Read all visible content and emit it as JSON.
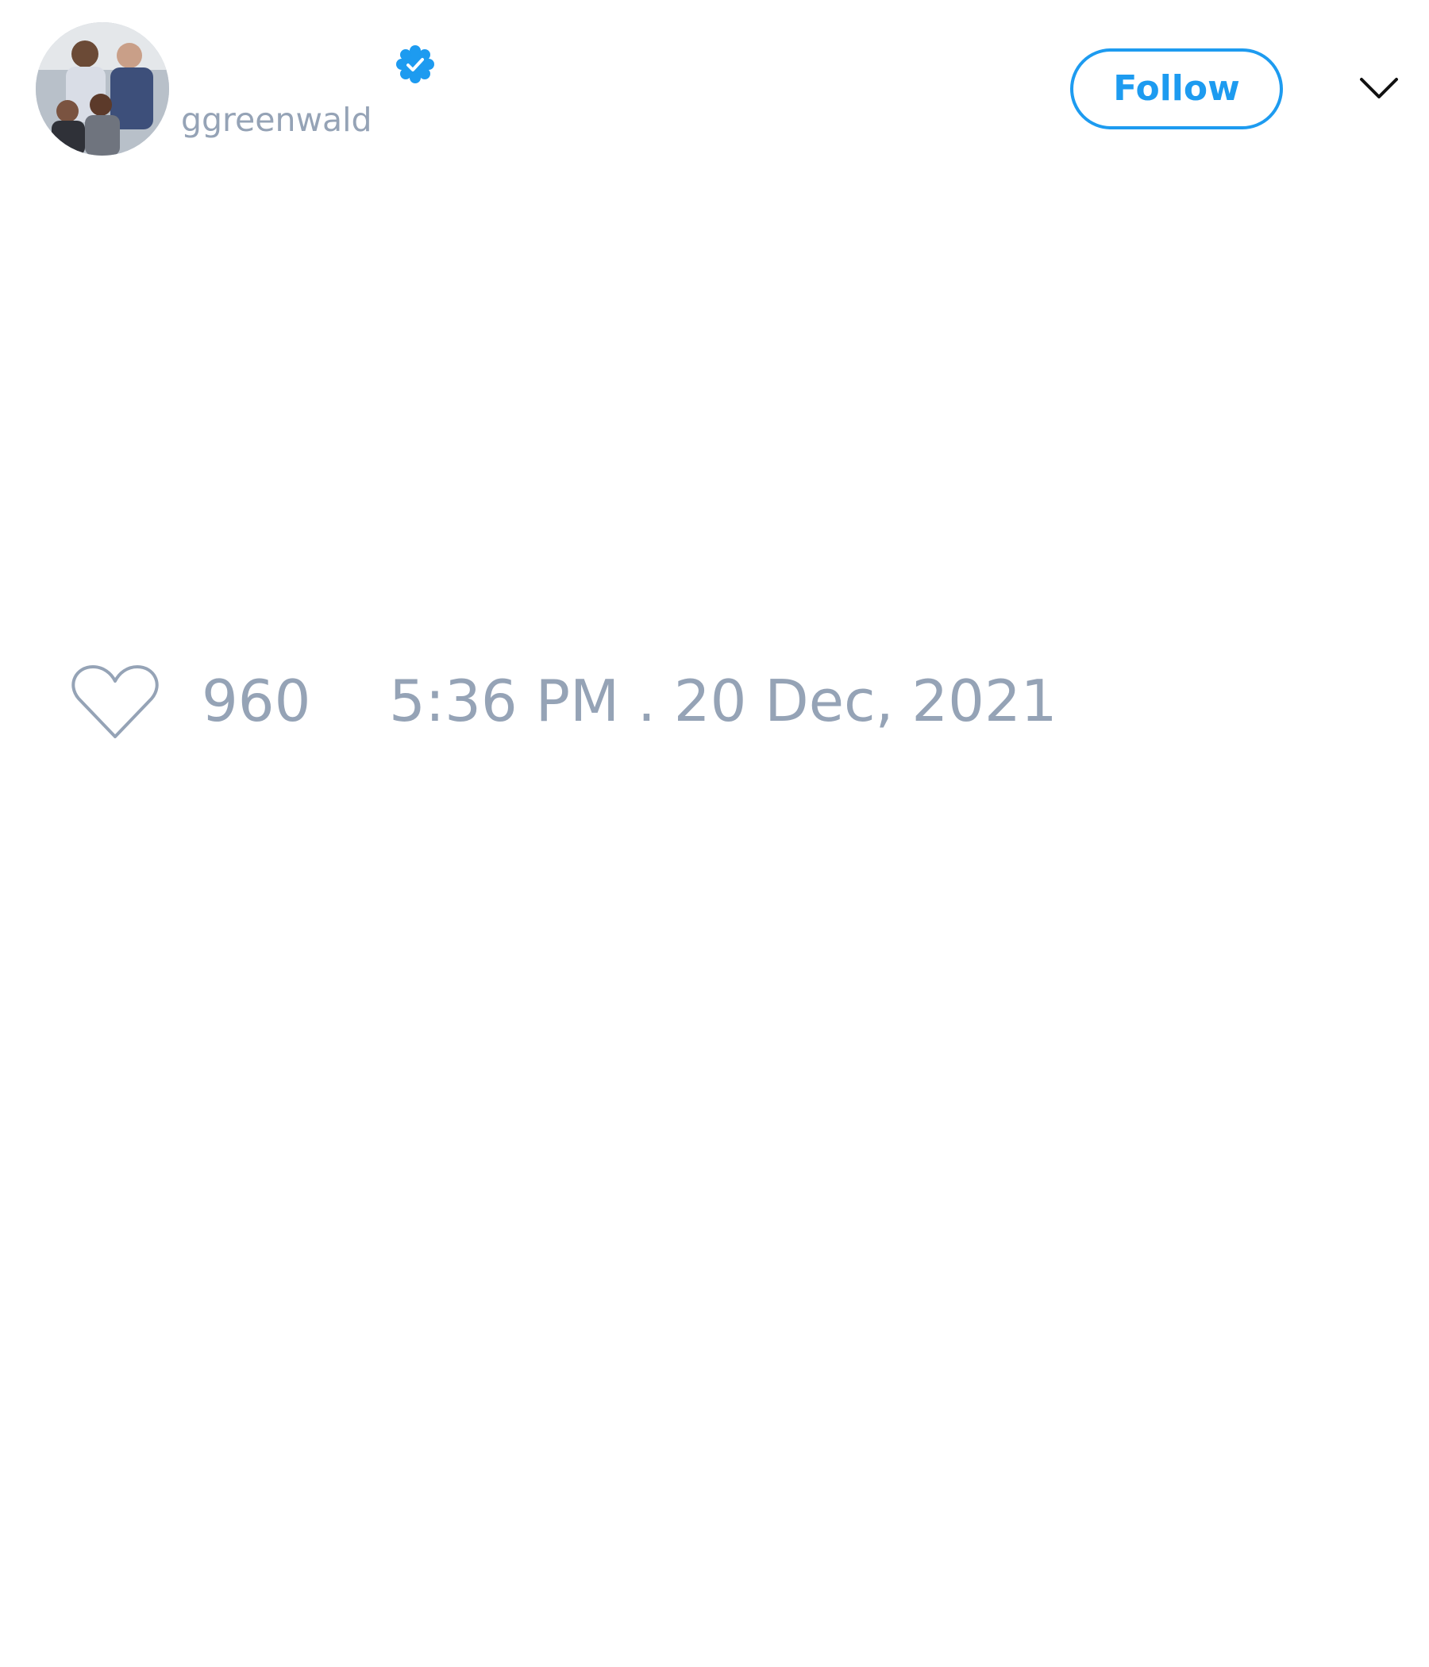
{
  "tweet": {
    "author": {
      "handle": "ggreenwald",
      "verified": true,
      "avatar_icon": "profile-photo"
    },
    "follow_label": "Follow",
    "menu_icon": "chevron-down-icon",
    "like_icon": "heart-outline-icon",
    "like_count": "960",
    "timestamp": "5:36 PM . 20 Dec, 2021"
  },
  "colors": {
    "accent": "#1d9bf0",
    "muted_text": "#95a3b6",
    "background": "#ffffff"
  }
}
